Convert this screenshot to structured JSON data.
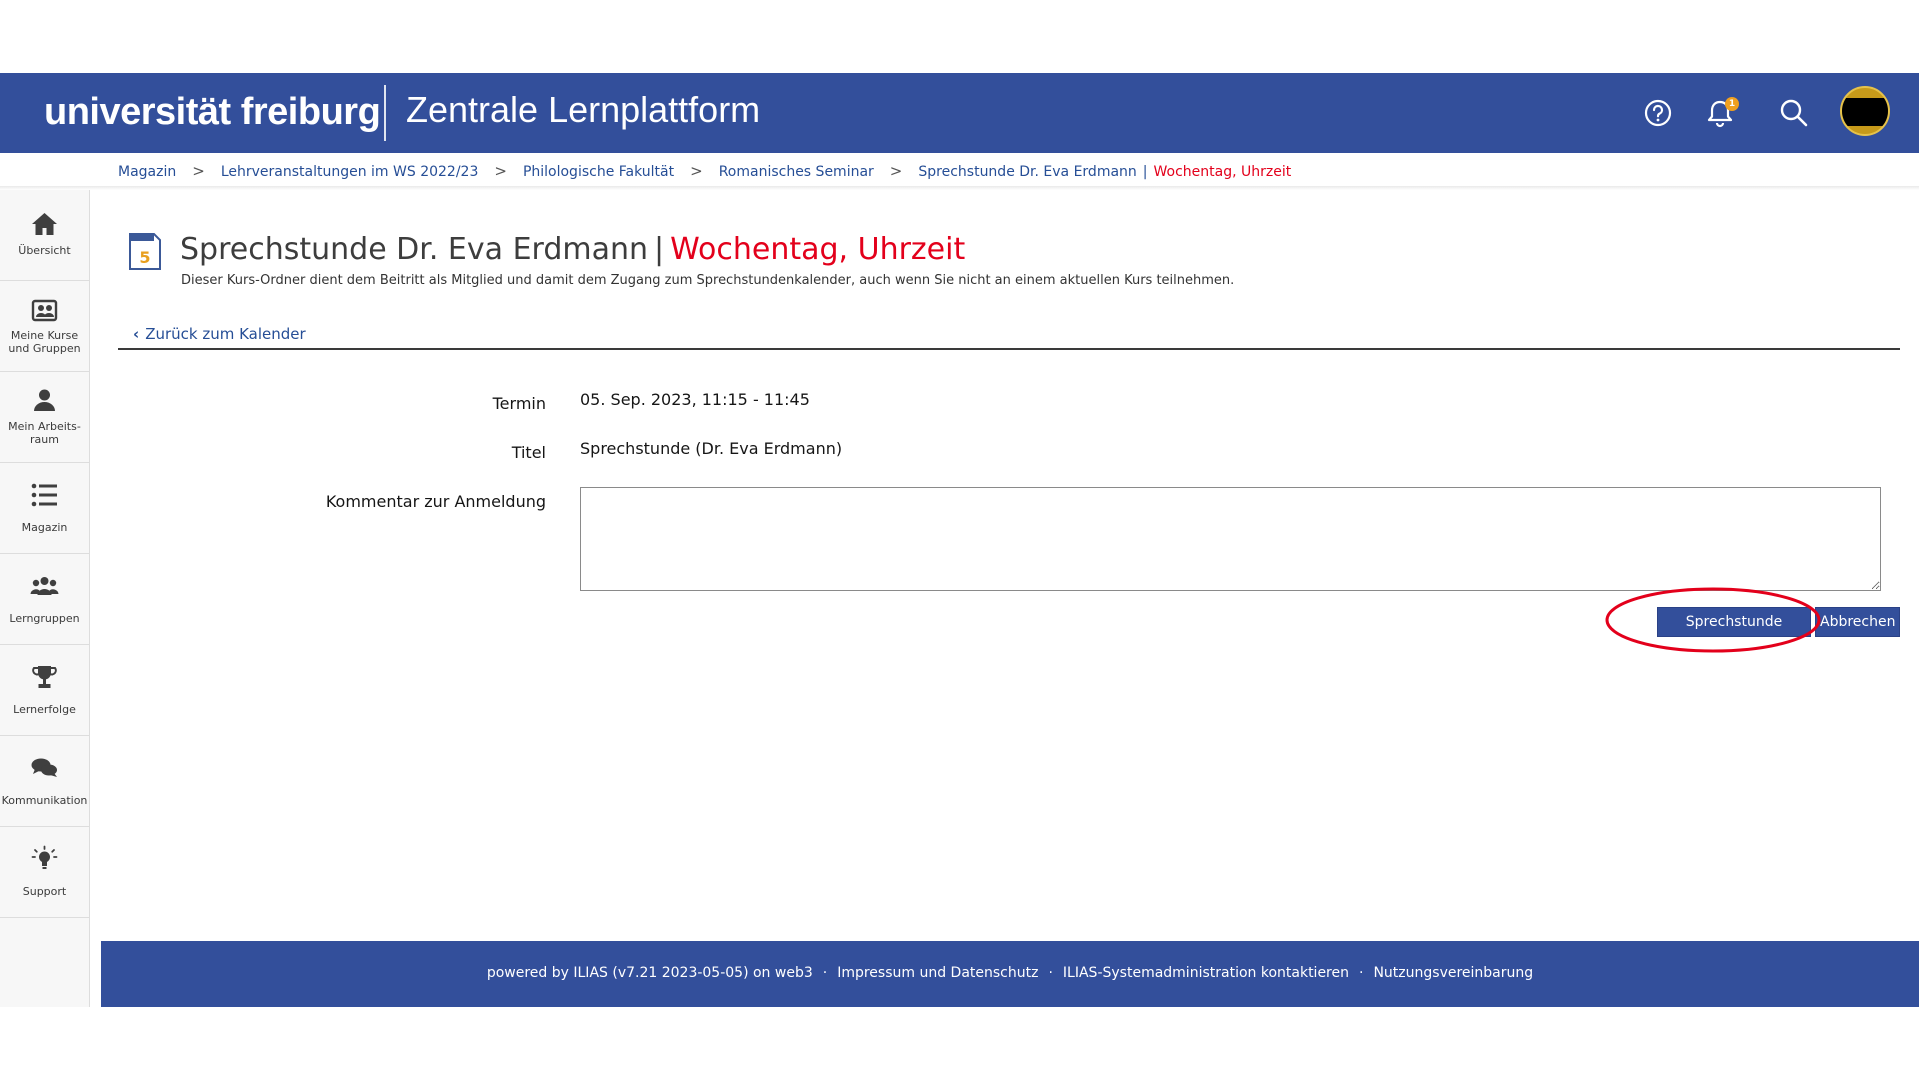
{
  "header": {
    "logo": "universität freiburg",
    "app_title": "Zentrale Lernplattform",
    "notification_count": "1",
    "bg_color": "#334f9b"
  },
  "breadcrumb": {
    "items": [
      "Magazin",
      "Lehrveranstaltungen im WS 2022/23",
      "Philologische Fakultät",
      "Romanisches Seminar",
      "Sprechstunde Dr. Eva Erdmann"
    ],
    "current_suffix": "Wochentag, Uhrzeit"
  },
  "sidebar": {
    "items": [
      {
        "label": "Übersicht",
        "icon": "home-icon"
      },
      {
        "label": "Meine Kurse und Gruppen",
        "icon": "courses-icon"
      },
      {
        "label": "Mein Arbeits-raum",
        "icon": "person-icon"
      },
      {
        "label": "Magazin",
        "icon": "list-icon"
      },
      {
        "label": "Lerngruppen",
        "icon": "group-icon"
      },
      {
        "label": "Lernerfolge",
        "icon": "trophy-icon"
      },
      {
        "label": "Kommunikation",
        "icon": "chat-icon"
      },
      {
        "label": "Support",
        "icon": "lightbulb-icon"
      }
    ]
  },
  "page": {
    "title": "Sprechstunde Dr. Eva Erdmann",
    "title_suffix": "Wochentag, Uhrzeit",
    "description": "Dieser Kurs-Ordner dient dem Beitritt als Mitglied und damit dem Zugang zum Sprechstundenkalender, auch wenn Sie nicht an einem aktuellen Kurs teilnehmen.",
    "back_link": "Zurück zum Kalender",
    "calendar_day": "5"
  },
  "form": {
    "termin_label": "Termin",
    "termin_value": "05. Sep. 2023, 11:15 - 11:45",
    "titel_label": "Titel",
    "titel_value": "Sprechstunde (Dr. Eva Erdmann)",
    "kommentar_label": "Kommentar zur Anmeldung",
    "kommentar_value": "",
    "book_button": "Sprechstunde buchen",
    "cancel_button": "Abbrechen"
  },
  "footer": {
    "powered": "powered by ILIAS (v7.21 2023-05-05) on web3",
    "links": [
      "Impressum und Datenschutz",
      "ILIAS-Systemadministration kontaktieren",
      "Nutzungsvereinbarung"
    ],
    "separator": "·"
  },
  "colors": {
    "primary": "#334f9b",
    "highlight": "#e3001b",
    "link": "#264e96"
  }
}
